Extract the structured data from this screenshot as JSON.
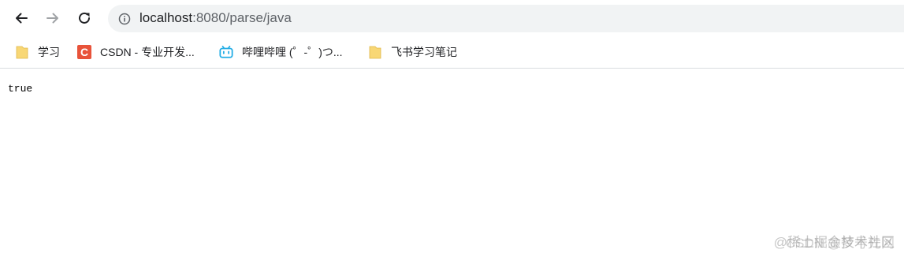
{
  "toolbar": {
    "back_icon": "arrow-left-icon",
    "forward_icon": "arrow-right-icon",
    "reload_icon": "reload-icon",
    "info_icon": "info-icon",
    "url_host": "localhost",
    "url_rest": ":8080/parse/java"
  },
  "bookmarks": [
    {
      "label": "学习",
      "icon": "folder-icon"
    },
    {
      "label": "CSDN - 专业开发...",
      "icon": "csdn-icon",
      "icon_text": "C"
    },
    {
      "label": "哔哩哔哩 (゜-゜)つ...",
      "icon": "bilibili-icon"
    },
    {
      "label": "飞书学习笔记",
      "icon": "folder-icon"
    }
  ],
  "page": {
    "body_text": "true"
  },
  "watermark": {
    "line1": "@稀土掘金技术社区",
    "line2": "CSDN @梦号先网"
  },
  "colors": {
    "omnibox_bg": "#f1f3f4",
    "folder": "#f8d775",
    "csdn": "#e8533a",
    "bilibili": "#23ade5"
  }
}
